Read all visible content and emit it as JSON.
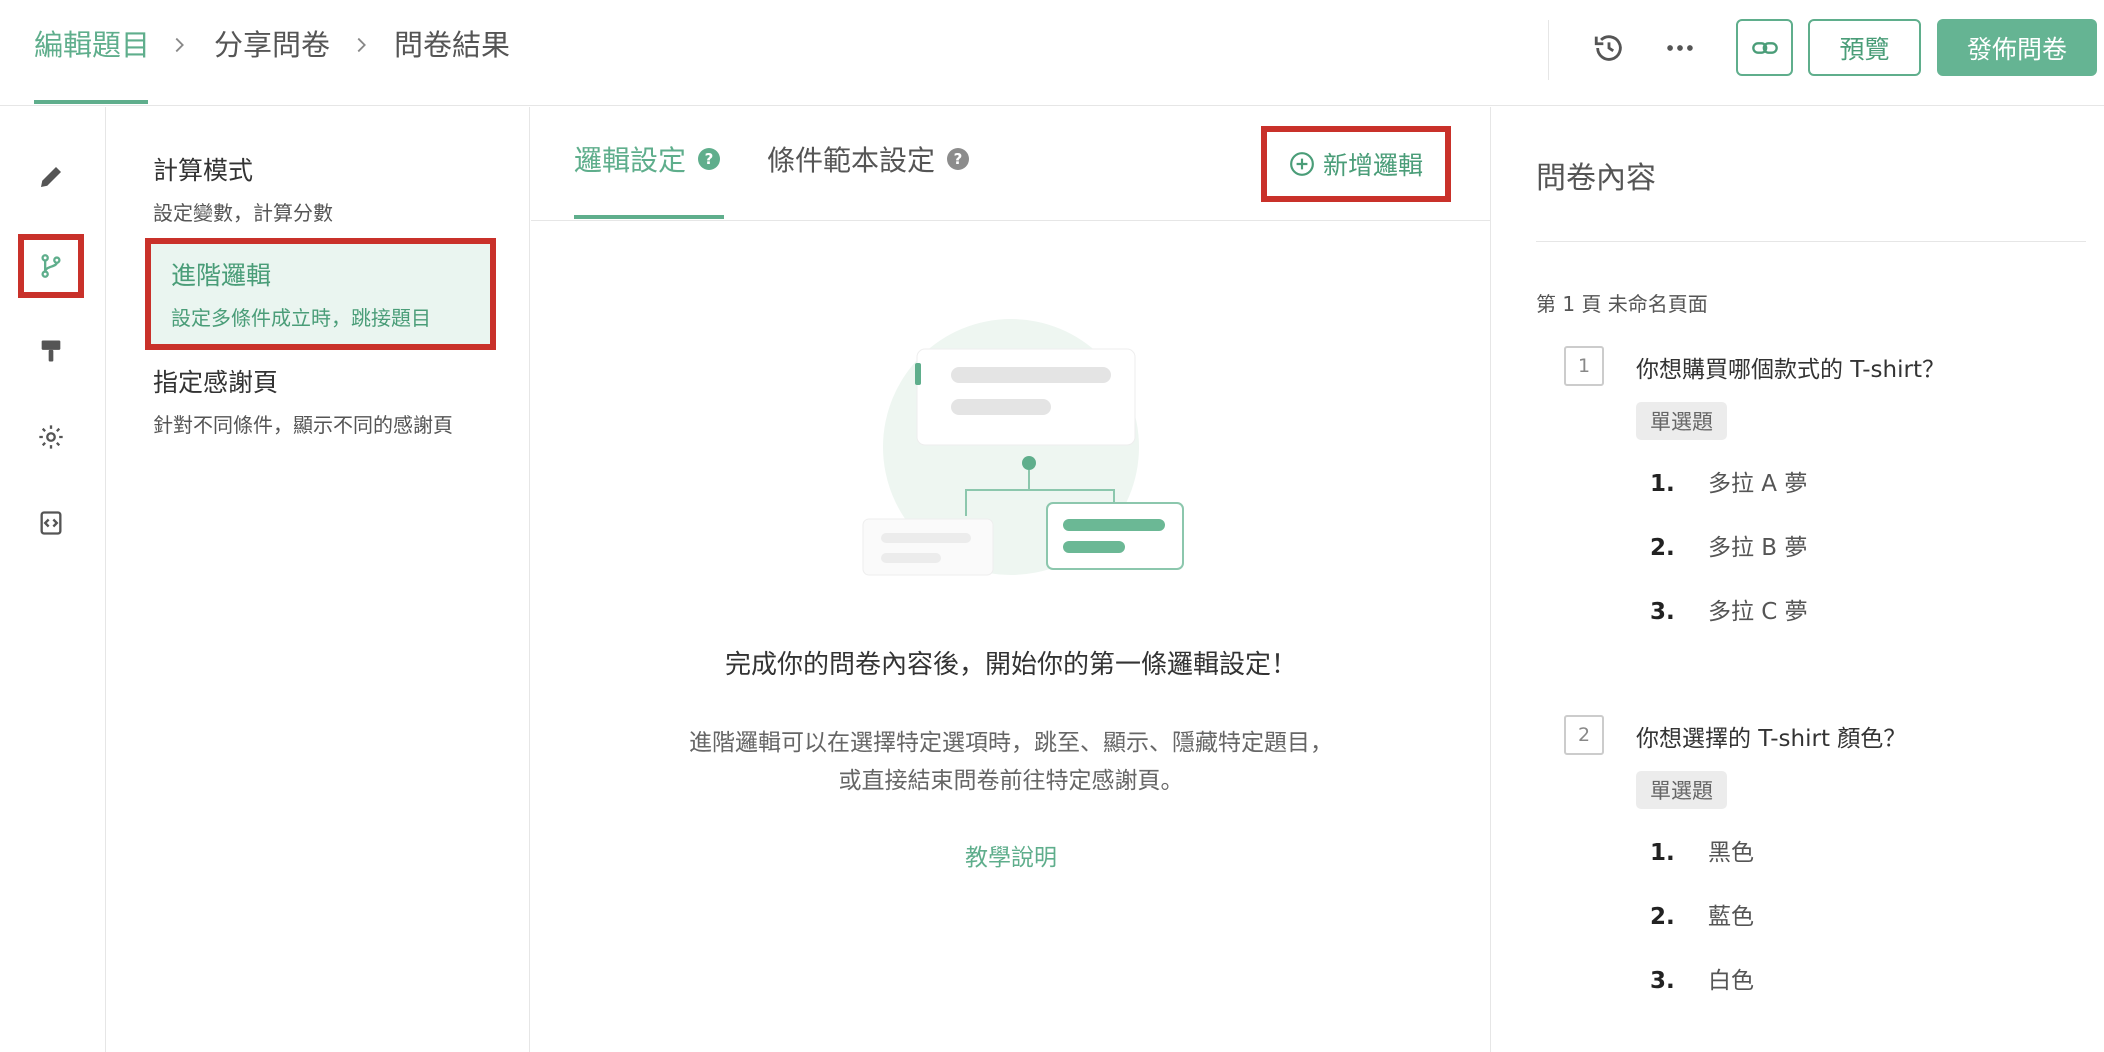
{
  "breadcrumb": {
    "items": [
      {
        "label": "編輯題目",
        "active": true
      },
      {
        "label": "分享問卷",
        "active": false
      },
      {
        "label": "問卷結果",
        "active": false
      }
    ]
  },
  "header_actions": {
    "history_icon": "history-icon",
    "more_icon": "more-horizontal-icon",
    "link_icon": "link-icon",
    "preview_label": "預覽",
    "publish_label": "發佈問卷"
  },
  "rail": {
    "items": [
      {
        "icon": "pencil-icon",
        "selected": false
      },
      {
        "icon": "branch-icon",
        "selected": true
      },
      {
        "icon": "paint-roller-icon",
        "selected": false
      },
      {
        "icon": "gear-icon",
        "selected": false
      },
      {
        "icon": "code-file-icon",
        "selected": false
      }
    ]
  },
  "modes": [
    {
      "title": "計算模式",
      "desc": "設定變數，計算分數",
      "active": false
    },
    {
      "title": "進階邏輯",
      "desc": "設定多條件成立時，跳接題目",
      "active": true
    },
    {
      "title": "指定感謝頁",
      "desc": "針對不同條件，顯示不同的感謝頁",
      "active": false
    }
  ],
  "center": {
    "tabs": [
      {
        "label": "邏輯設定",
        "active": true
      },
      {
        "label": "條件範本設定",
        "active": false
      }
    ],
    "add_logic_label": "新增邏輯",
    "empty_title": "完成你的問卷內容後，開始你的第一條邏輯設定！",
    "empty_desc": "進階邏輯可以在選擇特定選項時，跳至、顯示、隱藏特定題目，或直接結束問卷前往特定感謝頁。",
    "tutorial_label": "教學說明"
  },
  "survey": {
    "title": "問卷內容",
    "page_label": "第 1 頁 未命名頁面",
    "questions": [
      {
        "number": "1",
        "title": "你想購買哪個款式的 T-shirt？",
        "type": "單選題",
        "options": [
          {
            "n": "1.",
            "text": "多拉 A 夢"
          },
          {
            "n": "2.",
            "text": "多拉 B 夢"
          },
          {
            "n": "3.",
            "text": "多拉 C 夢"
          }
        ]
      },
      {
        "number": "2",
        "title": "你想選擇的 T-shirt 顏色？",
        "type": "單選題",
        "options": [
          {
            "n": "1.",
            "text": "黑色"
          },
          {
            "n": "2.",
            "text": "藍色"
          },
          {
            "n": "3.",
            "text": "白色"
          }
        ]
      }
    ]
  },
  "colors": {
    "accent": "#5fae8c",
    "accent_dark": "#4a9d78",
    "highlight_box": "#c9312a",
    "active_bg": "#eaf5f0"
  }
}
